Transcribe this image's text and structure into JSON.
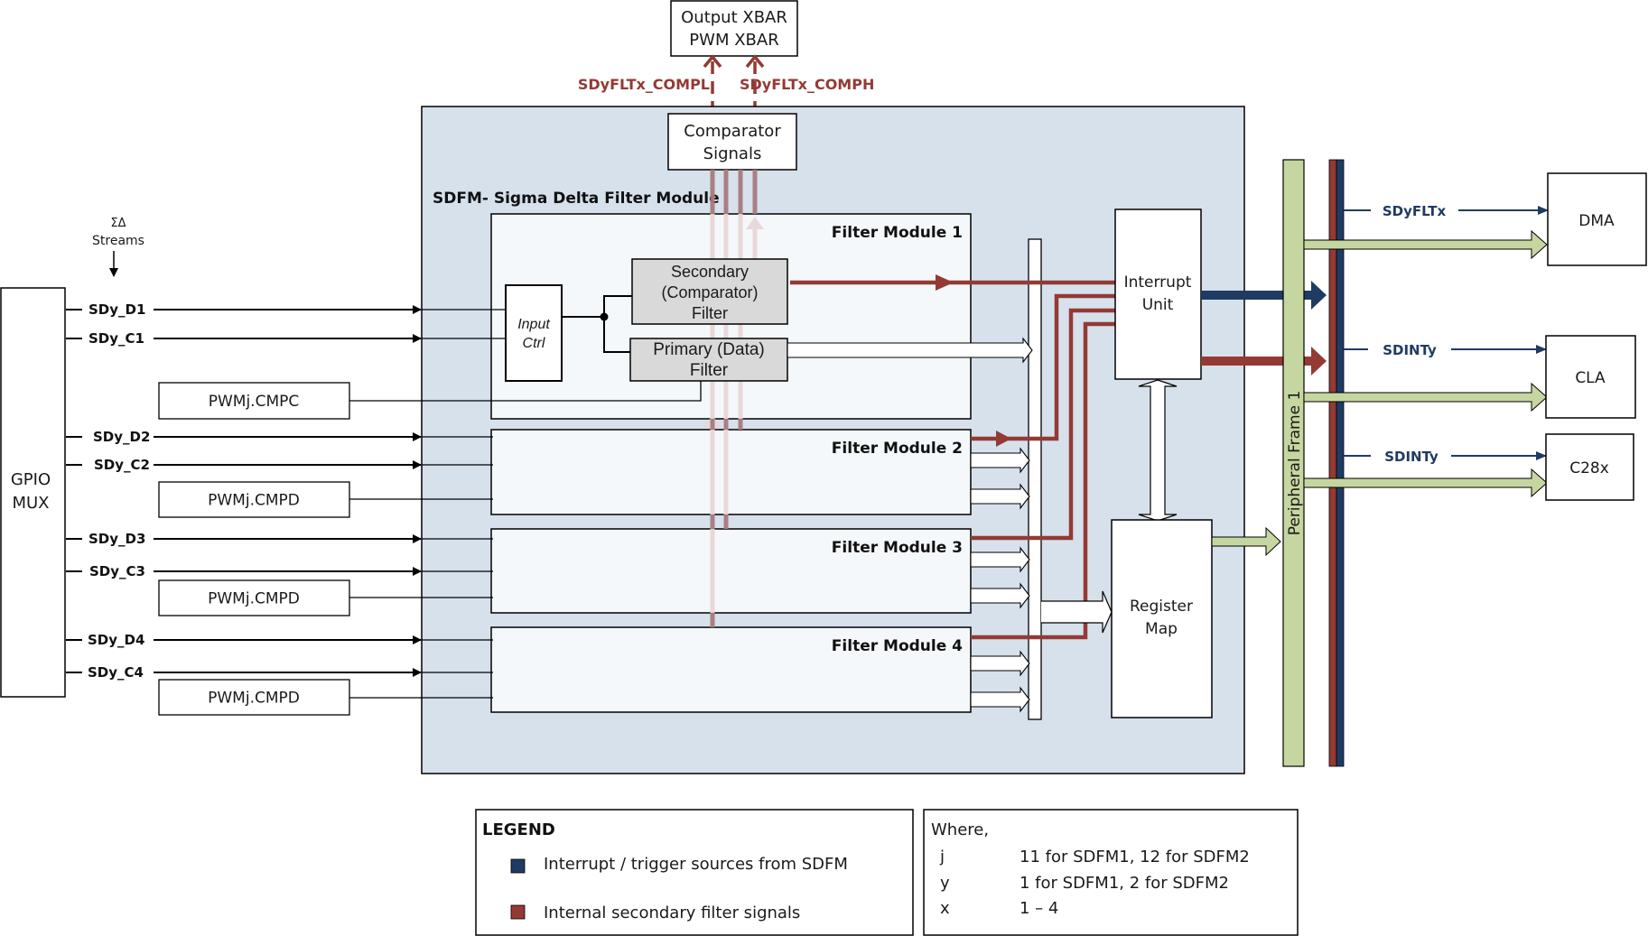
{
  "title": "SDFM- Sigma Delta Filter Module",
  "colors": {
    "sdfm_bg": "#d6e1ec",
    "filter_bg": "#f5f8fa",
    "filter_block": "#d9d9d9",
    "red_signal": "#933a34",
    "blue_signal": "#1f3b63",
    "peripheral_frame": "#c6d6a0"
  },
  "top": {
    "xbar_line1": "Output XBAR",
    "xbar_line2": "PWM XBAR",
    "compl_label": "SDyFLTx_COMPL",
    "comph_label": "SDyFLTx_COMPH",
    "comparator_line1": "Comparator",
    "comparator_line2": "Signals"
  },
  "left": {
    "streams_line1": "ΣΔ",
    "streams_line2": "Streams",
    "gpio_line1": "GPIO",
    "gpio_line2": "MUX",
    "inputs": [
      "SDy_D1",
      "SDy_C1",
      "SDy_D2",
      "SDy_C2",
      "SDy_D3",
      "SDy_C3",
      "SDy_D4",
      "SDy_C4"
    ],
    "pwm": [
      "PWMj.CMPC",
      "PWMj.CMPD",
      "PWMj.CMPD",
      "PWMj.CMPD"
    ]
  },
  "filters": {
    "modules": [
      "Filter Module 1",
      "Filter Module 2",
      "Filter Module 3",
      "Filter Module 4"
    ],
    "input_ctrl_line1": "Input",
    "input_ctrl_line2": "Ctrl",
    "secondary_line1": "Secondary",
    "secondary_line2": "(Comparator)",
    "secondary_line3": "Filter",
    "primary_line1": "Primary (Data)",
    "primary_line2": "Filter"
  },
  "units": {
    "interrupt_line1": "Interrupt",
    "interrupt_line2": "Unit",
    "register_line1": "Register",
    "register_line2": "Map",
    "peripheral_frame": "Peripheral Frame 1"
  },
  "targets": {
    "dma": "DMA",
    "cla": "CLA",
    "c28x": "C28x",
    "dma_signal": "SDyFLTx",
    "cla_signal": "SDINTy",
    "c28x_signal": "SDINTy"
  },
  "legend": {
    "title": "LEGEND",
    "items": [
      {
        "label": "Interrupt / trigger sources from SDFM",
        "color": "#1f3b63"
      },
      {
        "label": "Internal secondary filter signals",
        "color": "#933a34"
      }
    ]
  },
  "where": {
    "title": "Where,",
    "rows": [
      {
        "var": "j",
        "desc": "11 for SDFM1, 12 for SDFM2"
      },
      {
        "var": "y",
        "desc": "1 for SDFM1, 2 for SDFM2"
      },
      {
        "var": "x",
        "desc": "1 – 4"
      }
    ]
  }
}
